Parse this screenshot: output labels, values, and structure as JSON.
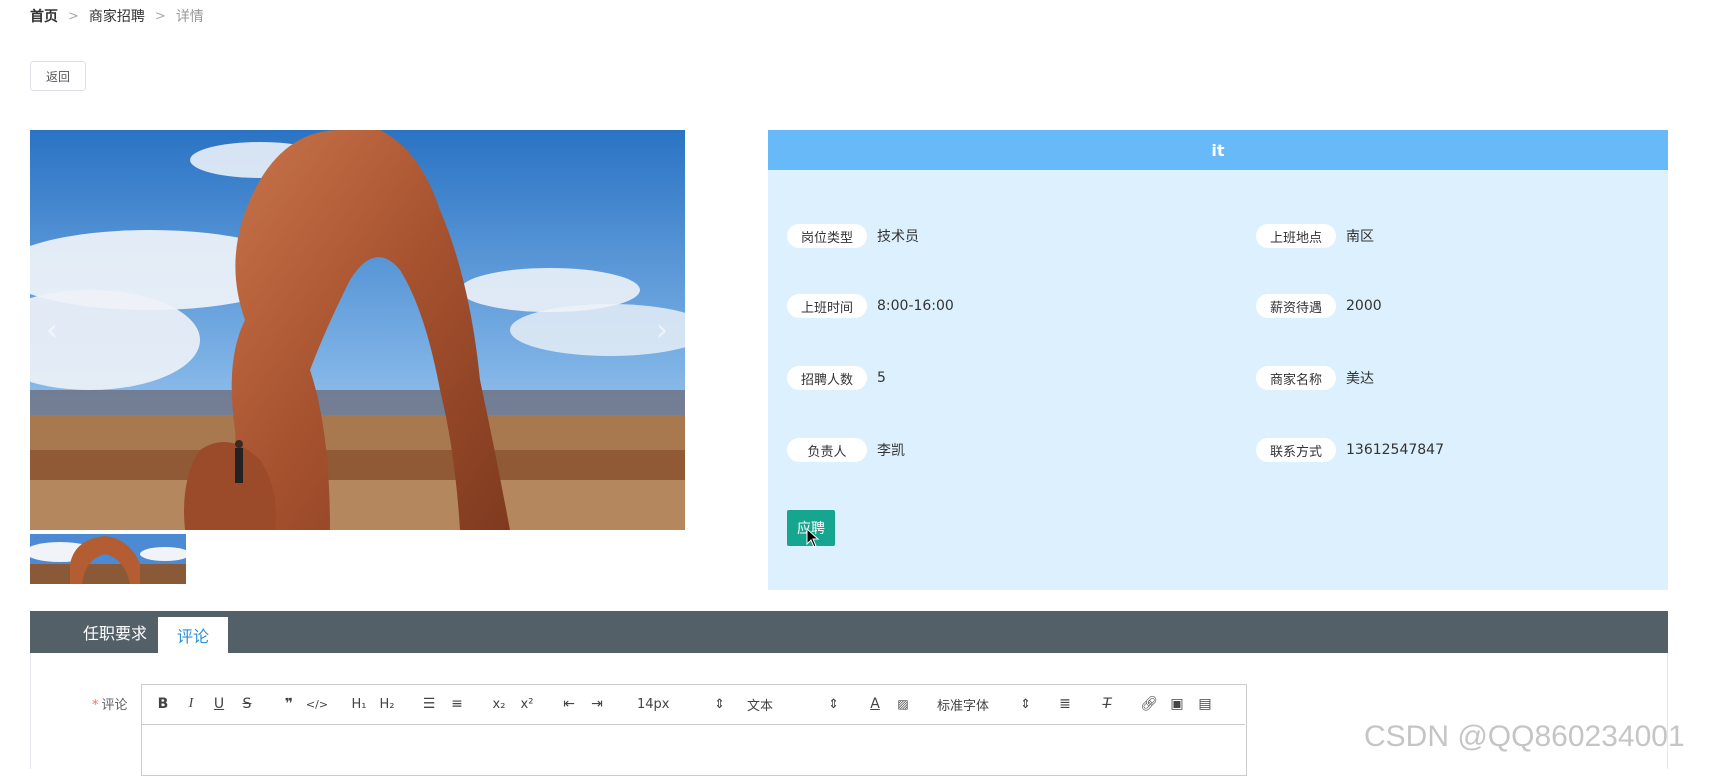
{
  "breadcrumb": {
    "home": "首页",
    "section": "商家招聘",
    "current": "详情",
    "separator": ">"
  },
  "back_button": "返回",
  "job": {
    "title": "it",
    "fields": [
      {
        "label": "岗位类型",
        "value": "技术员"
      },
      {
        "label": "上班地点",
        "value": "南区"
      },
      {
        "label": "上班时间",
        "value": "8:00-16:00"
      },
      {
        "label": "薪资待遇",
        "value": "2000"
      },
      {
        "label": "招聘人数",
        "value": "5"
      },
      {
        "label": "商家名称",
        "value": "美达"
      },
      {
        "label": "负责人",
        "value": "李凯"
      },
      {
        "label": "联系方式",
        "value": "13612547847"
      }
    ],
    "apply_button": "应聘"
  },
  "tabs": [
    {
      "label": "任职要求",
      "active": false
    },
    {
      "label": "评论",
      "active": true
    }
  ],
  "comment": {
    "label": "评论",
    "required_mark": "*",
    "toolbar": {
      "font_size": "14px",
      "header": "文本",
      "font_family": "标准字体"
    }
  },
  "watermark": "CSDN @QQ860234001",
  "colors": {
    "panel_bg": "#dcf1fd",
    "panel_header": "#67b9f8",
    "apply_button": "#16a58f",
    "tabs_bar": "#546068",
    "active_tab_text": "#2b8fd6"
  }
}
